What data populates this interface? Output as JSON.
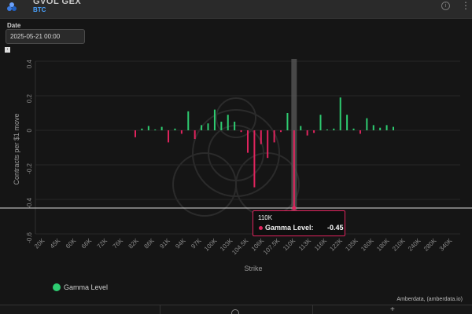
{
  "header": {
    "title": "GVOL GEX",
    "subtitle": "BTC",
    "logo_icon": "gvol-logo-icon",
    "info_icon": "info-icon",
    "menu_icon": "kebab-menu-icon"
  },
  "date_filter": {
    "label": "Date",
    "value": "2025-05-21 00:00"
  },
  "legend": {
    "label": "Gamma Level",
    "color": "#2ecc71"
  },
  "credit": "Amberdata, (amberdata.io)",
  "tooltip": {
    "strike": "110K",
    "series": "Gamma Level",
    "value": "-0.45",
    "color": "#e0245e"
  },
  "colors": {
    "positive": "#2ecc71",
    "negative": "#e0245e",
    "highlight": "#555555"
  },
  "chart_data": {
    "type": "bar",
    "title": "",
    "xlabel": "Strike",
    "ylabel": "Contracts per $1 move",
    "ylim": [
      -0.6,
      0.4
    ],
    "yticks": [
      "0.4",
      "0.2",
      "0",
      "-0.2",
      "-0.4",
      "-0.6"
    ],
    "categories": [
      "20K",
      "45K",
      "60K",
      "66K",
      "72K",
      "76K",
      "82K",
      "86K",
      "91K",
      "94K",
      "97K",
      "100K",
      "103K",
      "104.5K",
      "106K",
      "107.5K",
      "110K",
      "113K",
      "116K",
      "122K",
      "135K",
      "160K",
      "180K",
      "210K",
      "240K",
      "280K",
      "340K"
    ],
    "highlight_category": "110K",
    "highlight_value": -0.45,
    "series": [
      {
        "name": "Gamma Level",
        "values": [
          -0.04,
          0.01,
          0.025,
          0.005,
          0.02,
          -0.07,
          0.01,
          -0.02,
          0.11,
          -0.05,
          0.03,
          0.04,
          0.12,
          0.05,
          0.09,
          0.05,
          -0.01,
          -0.13,
          -0.33,
          -0.08,
          -0.16,
          -0.07,
          -0.01,
          0.1,
          -0.45,
          0.025,
          -0.03,
          -0.015,
          0.09,
          0.005,
          0.01,
          0.19,
          0.09,
          0.01,
          -0.02,
          0.07,
          0.03,
          0.015,
          0.03,
          0.02
        ]
      }
    ]
  }
}
